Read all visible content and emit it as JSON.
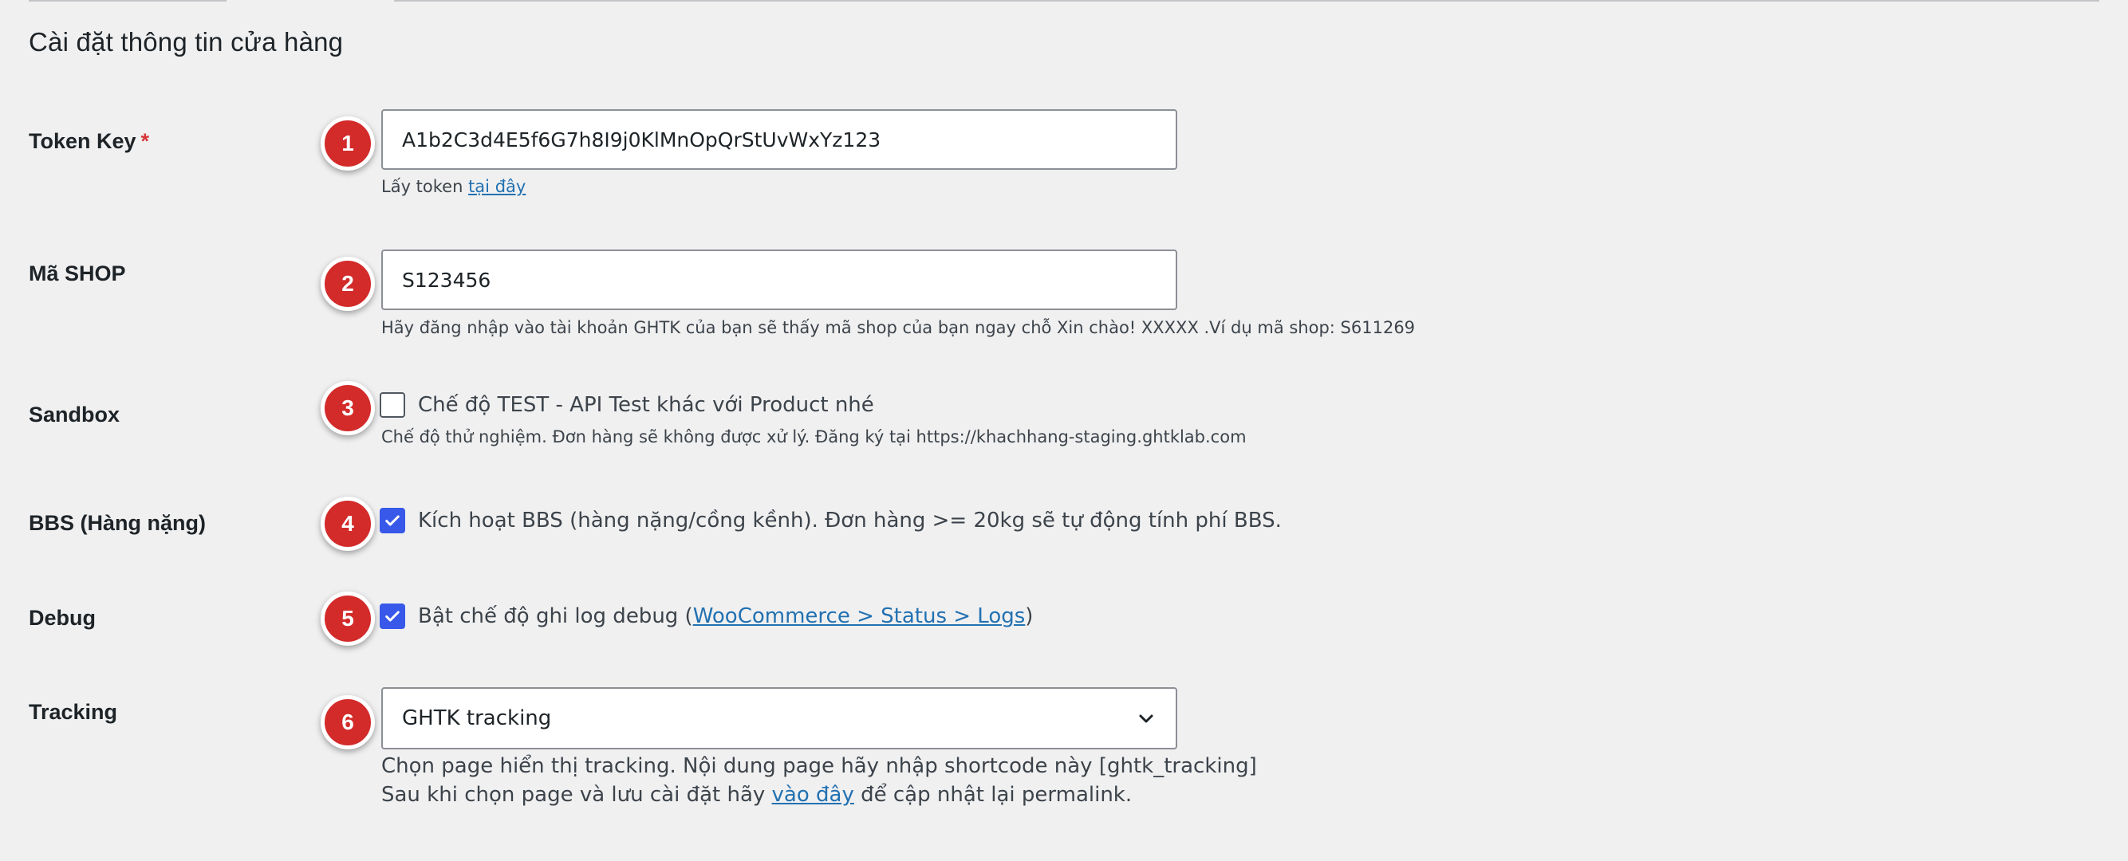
{
  "section_title": "Cài đặt thông tin cửa hàng",
  "token": {
    "label": "Token Key",
    "required_mark": "*",
    "badge": "1",
    "value": "A1b2C3d4E5f6G7h8I9j0KlMnOpQrStUvWxYz123",
    "desc_prefix": "Lấy token ",
    "desc_link": "tại đây"
  },
  "shop": {
    "label": "Mã SHOP",
    "badge": "2",
    "value": "S123456",
    "desc": "Hãy đăng nhập vào tài khoản GHTK của bạn sẽ thấy mã shop của bạn ngay chỗ Xin chào! XXXXX .Ví dụ mã shop: S611269"
  },
  "sandbox": {
    "label": "Sandbox",
    "badge": "3",
    "checked": false,
    "checkbox_label": "Chế độ TEST - API Test khác với Product nhé",
    "desc": "Chế độ thử nghiệm. Đơn hàng sẽ không được xử lý. Đăng ký tại https://khachhang-staging.ghtklab.com"
  },
  "bbs": {
    "label": "BBS (Hàng nặng)",
    "badge": "4",
    "checked": true,
    "checkbox_label": "Kích hoạt BBS (hàng nặng/cồng kềnh). Đơn hàng >= 20kg sẽ tự động tính phí BBS."
  },
  "debug": {
    "label": "Debug",
    "badge": "5",
    "checked": true,
    "checkbox_label_prefix": "Bật chế độ ghi log debug (",
    "checkbox_link": "WooCommerce > Status > Logs",
    "checkbox_label_suffix": ")"
  },
  "tracking": {
    "label": "Tracking",
    "badge": "6",
    "selected": "GHTK tracking",
    "desc_line1": "Chọn page hiển thị tracking. Nội dung page hãy nhập shortcode này [ghtk_tracking]",
    "desc_line2_prefix": "Sau khi chọn page và lưu cài đặt hãy ",
    "desc_line2_link": "vào đây",
    "desc_line2_suffix": " để cập nhật lại permalink."
  },
  "colors": {
    "badge": "#d32a2a",
    "checkbox_checked": "#3858e9",
    "link": "#2271b1",
    "required": "#d63638"
  },
  "icons": {
    "checkmark": "check-icon",
    "dropdown": "chevron-down-icon"
  }
}
